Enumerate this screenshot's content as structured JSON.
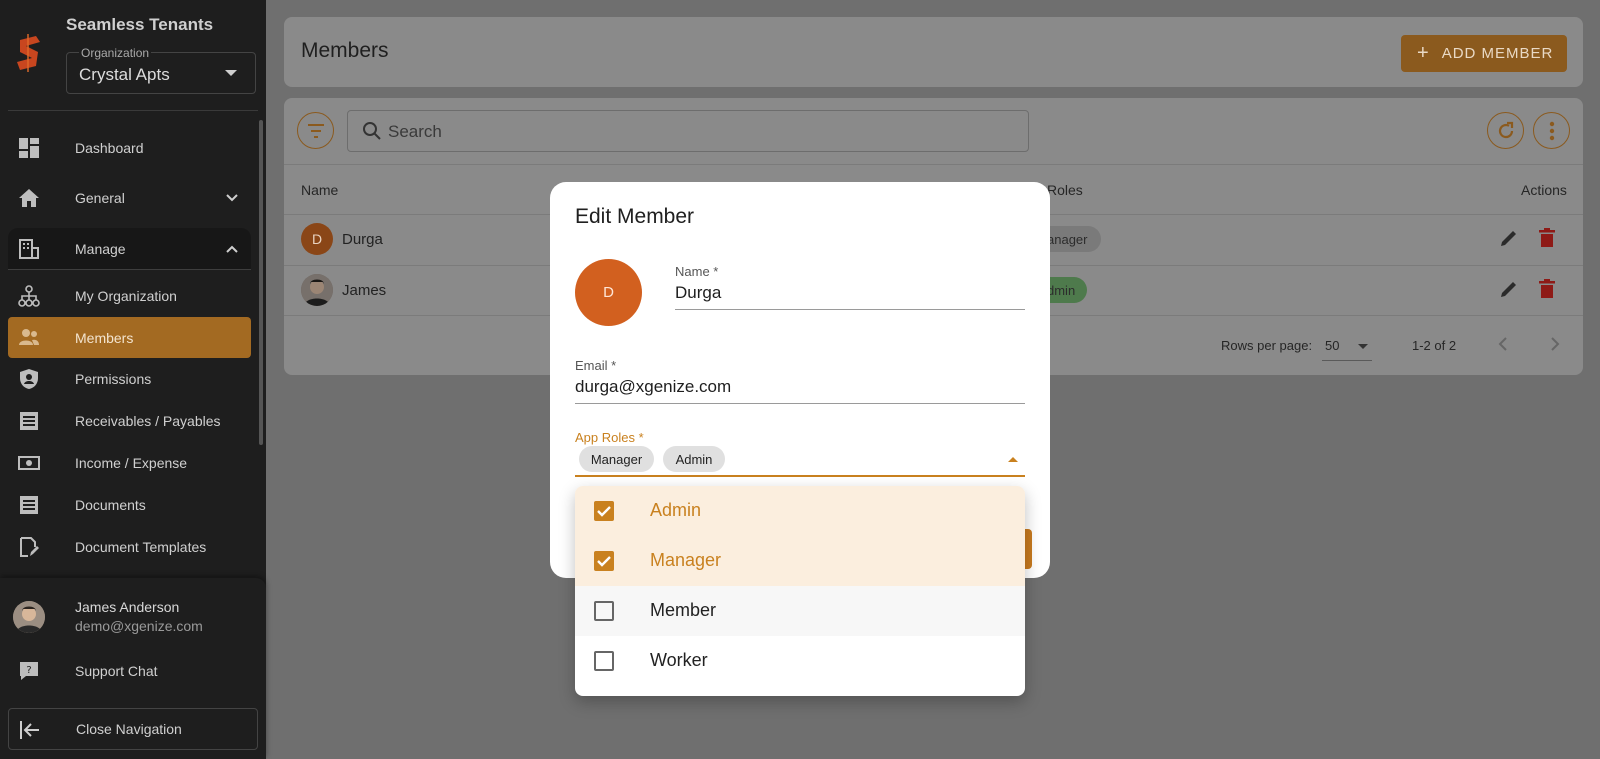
{
  "sidebar": {
    "brand": "Seamless Tenants",
    "org_label": "Organization",
    "org_value": "Crystal Apts",
    "items": [
      {
        "label": "Dashboard"
      },
      {
        "label": "General"
      },
      {
        "label": "Manage"
      },
      {
        "label": "My Organization"
      },
      {
        "label": "Members"
      },
      {
        "label": "Permissions"
      },
      {
        "label": "Receivables / Payables"
      },
      {
        "label": "Income / Expense"
      },
      {
        "label": "Documents"
      },
      {
        "label": "Document Templates"
      }
    ],
    "user": {
      "name": "James Anderson",
      "email": "demo@xgenize.com"
    },
    "support": "Support Chat",
    "close_nav": "Close Navigation"
  },
  "header": {
    "title": "Members",
    "add_button": "ADD MEMBER"
  },
  "toolbar": {
    "search_placeholder": "Search"
  },
  "table": {
    "columns": {
      "name": "Name",
      "roles": "Roles",
      "actions": "Actions"
    },
    "rows": [
      {
        "initial": "D",
        "name": "Durga",
        "role_chip": "anager"
      },
      {
        "initial": "",
        "name": "James",
        "role_chip": "dmin"
      }
    ],
    "rows_per_page_label": "Rows per page:",
    "rows_per_page": "50",
    "range": "1-2 of 2"
  },
  "modal": {
    "title": "Edit Member",
    "avatar_initial": "D",
    "name_label": "Name *",
    "name_value": "Durga",
    "email_label": "Email *",
    "email_value": "durga@xgenize.com",
    "roles_label": "App Roles *",
    "selected_roles": [
      "Manager",
      "Admin"
    ],
    "options": [
      {
        "label": "Admin",
        "checked": true
      },
      {
        "label": "Manager",
        "checked": true
      },
      {
        "label": "Member",
        "checked": false
      },
      {
        "label": "Worker",
        "checked": false
      }
    ]
  },
  "colors": {
    "accent": "#c9811f",
    "avatar": "#d2601f",
    "sidebar": "#1e1e1e"
  }
}
